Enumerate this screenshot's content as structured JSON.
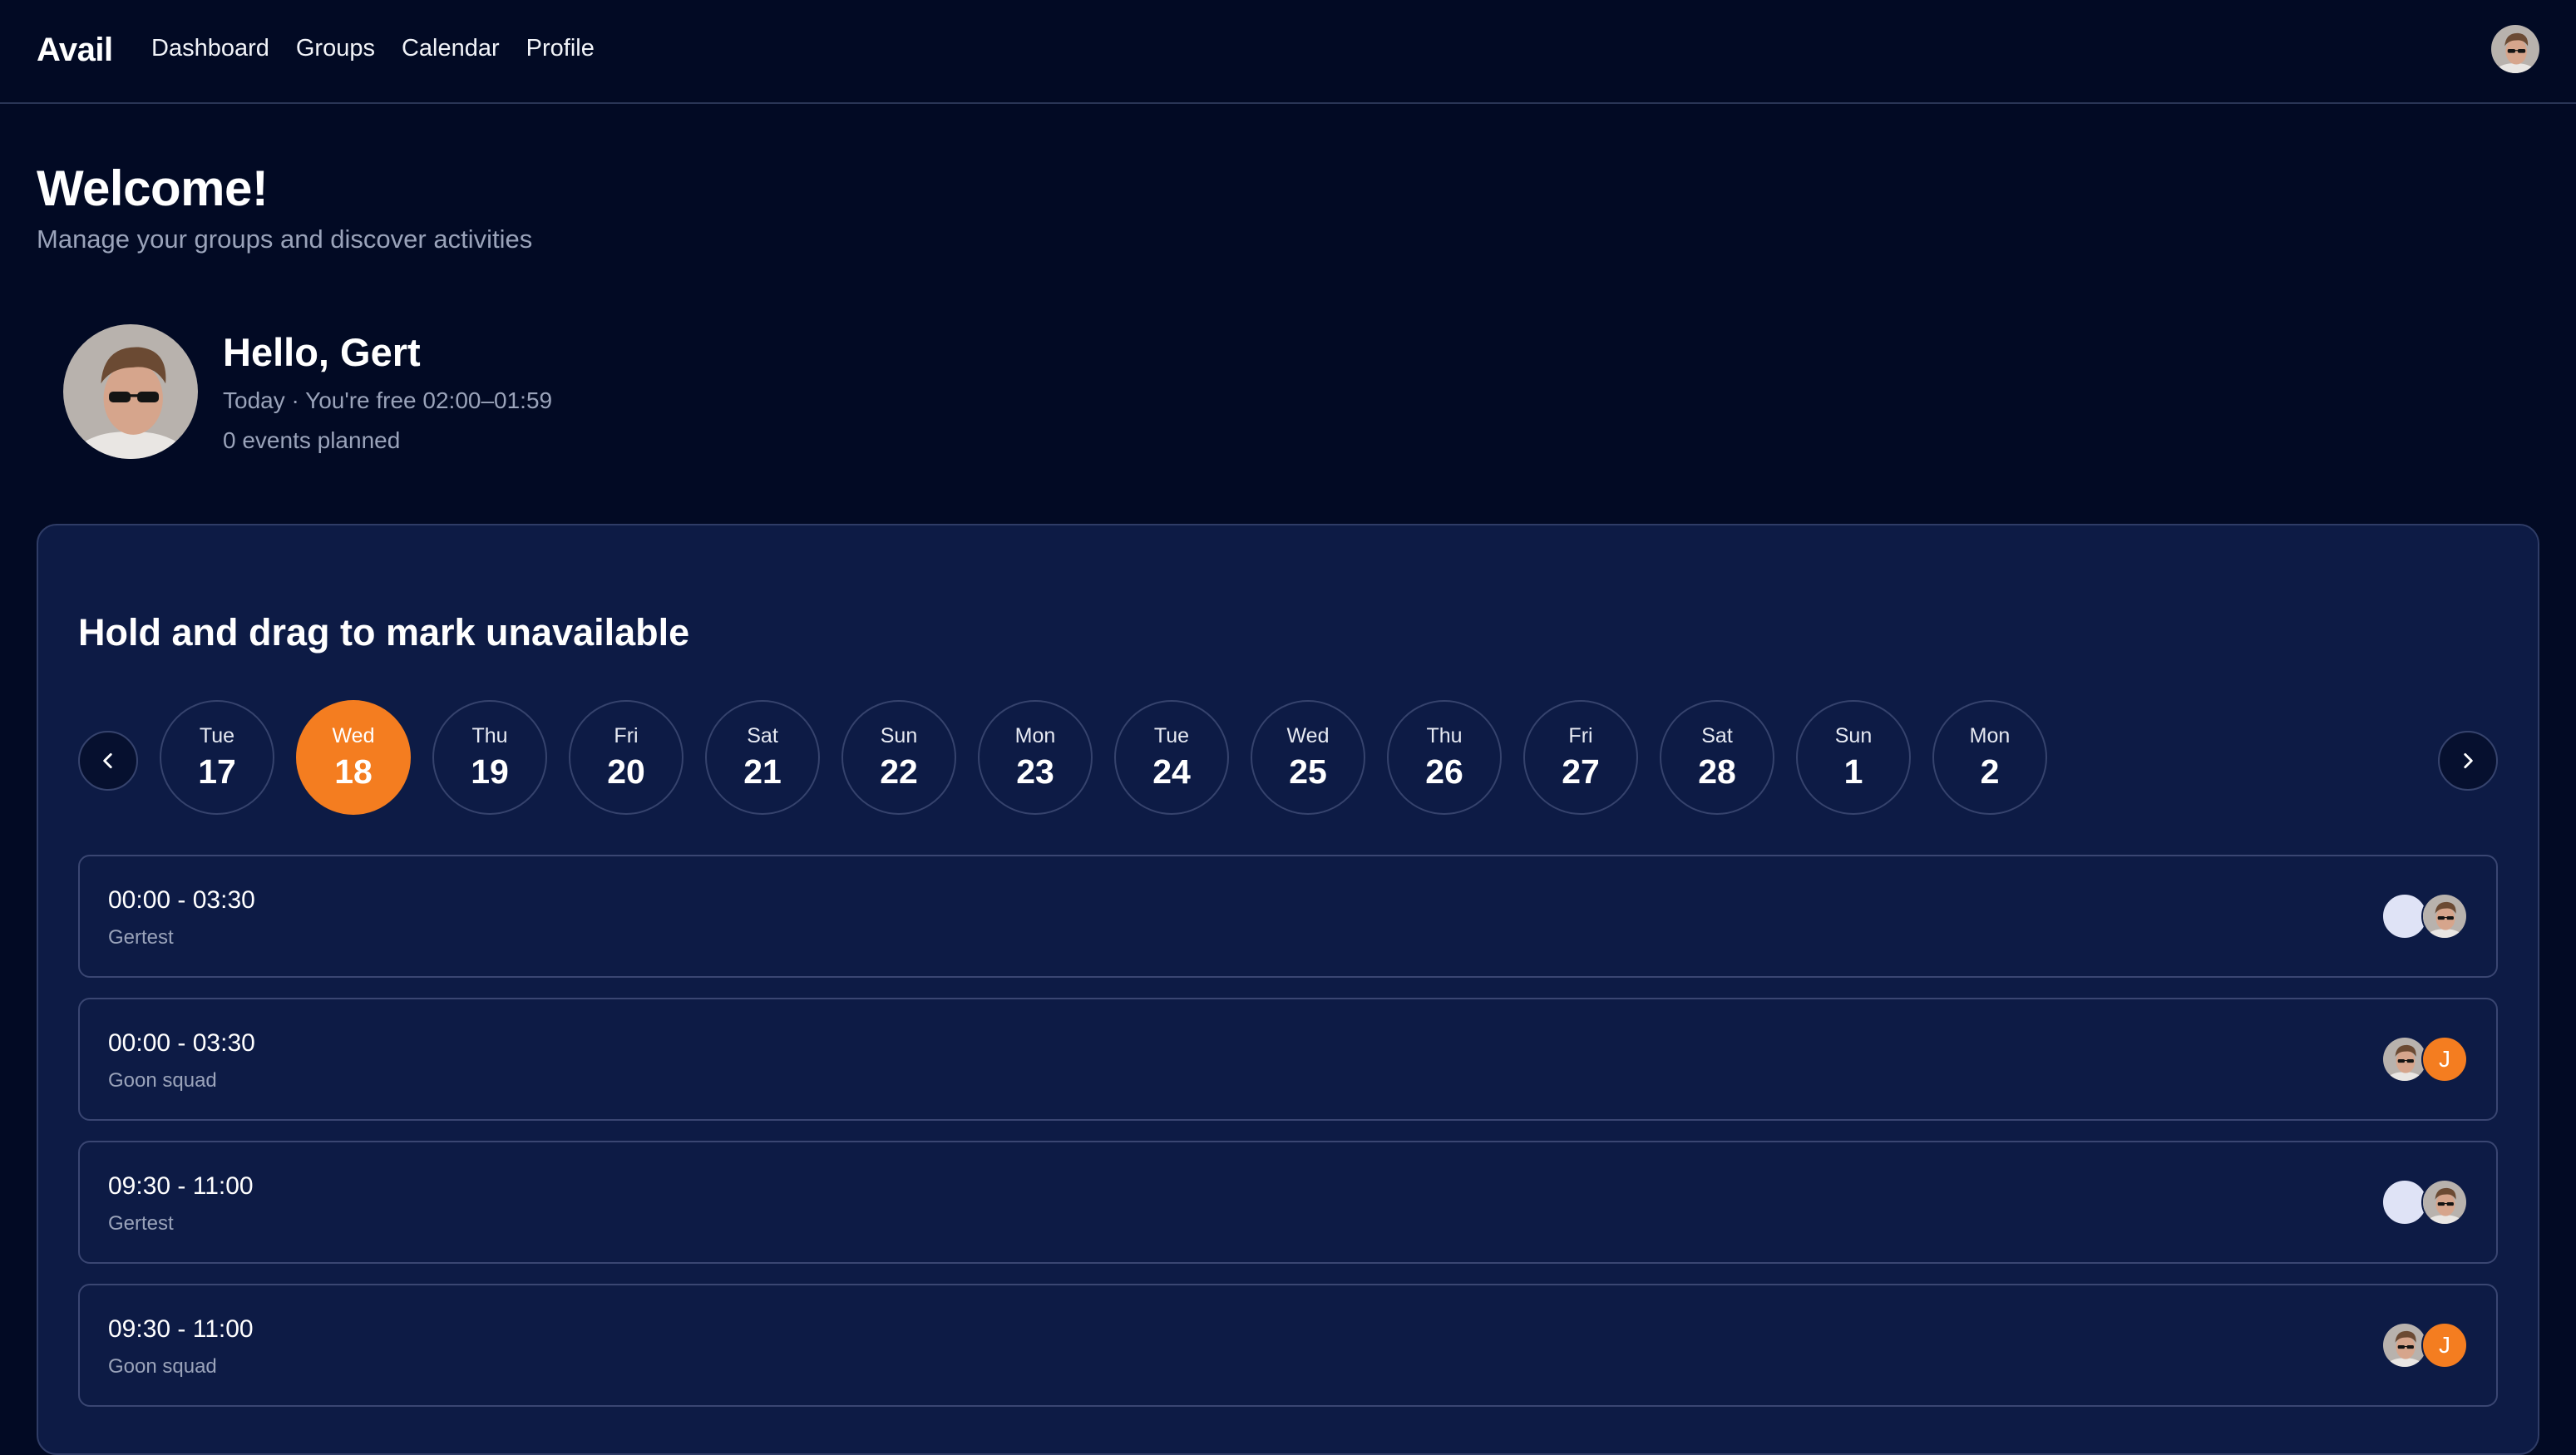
{
  "app": {
    "brand": "Avail"
  },
  "nav": [
    {
      "label": "Dashboard"
    },
    {
      "label": "Groups"
    },
    {
      "label": "Calendar"
    },
    {
      "label": "Profile"
    }
  ],
  "welcome": {
    "title": "Welcome!",
    "subtitle": "Manage your groups and discover activities"
  },
  "profile": {
    "greeting": "Hello, Gert",
    "free_line": "Today · You're free 02:00–01:59",
    "events_line": "0 events planned"
  },
  "availability": {
    "title": "Hold and drag to mark unavailable",
    "prev_icon": "chevron-left-icon",
    "next_icon": "chevron-right-icon",
    "days": [
      {
        "dow": "Tue",
        "num": "17"
      },
      {
        "dow": "Wed",
        "num": "18",
        "selected": true
      },
      {
        "dow": "Thu",
        "num": "19"
      },
      {
        "dow": "Fri",
        "num": "20"
      },
      {
        "dow": "Sat",
        "num": "21"
      },
      {
        "dow": "Sun",
        "num": "22"
      },
      {
        "dow": "Mon",
        "num": "23"
      },
      {
        "dow": "Tue",
        "num": "24"
      },
      {
        "dow": "Wed",
        "num": "25"
      },
      {
        "dow": "Thu",
        "num": "26"
      },
      {
        "dow": "Fri",
        "num": "27"
      },
      {
        "dow": "Sat",
        "num": "28"
      },
      {
        "dow": "Sun",
        "num": "1"
      },
      {
        "dow": "Mon",
        "num": "2"
      }
    ],
    "slots": [
      {
        "time": "00:00 - 03:30",
        "group": "Gertest",
        "avatars": [
          "light",
          "photo"
        ]
      },
      {
        "time": "00:00 - 03:30",
        "group": "Goon squad",
        "avatars": [
          "photo",
          "J"
        ]
      },
      {
        "time": "09:30 - 11:00",
        "group": "Gertest",
        "avatars": [
          "light",
          "photo"
        ]
      },
      {
        "time": "09:30 - 11:00",
        "group": "Goon squad",
        "avatars": [
          "photo",
          "J"
        ]
      }
    ]
  },
  "colors": {
    "background": "#020a24",
    "card": "#0d1b45",
    "accent": "#f47d20",
    "muted_text": "#9aa3ba"
  }
}
